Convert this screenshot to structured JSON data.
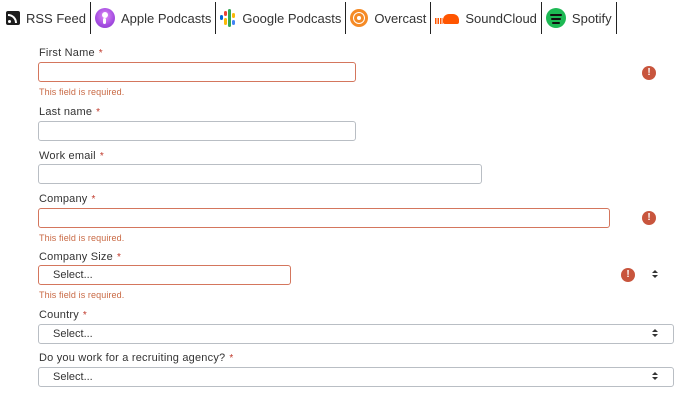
{
  "podcast_links": [
    {
      "label": "RSS Feed",
      "icon": "rss-icon"
    },
    {
      "label": "Apple Podcasts",
      "icon": "apple-podcasts-icon"
    },
    {
      "label": "Google Podcasts",
      "icon": "google-podcasts-icon"
    },
    {
      "label": "Overcast",
      "icon": "overcast-icon"
    },
    {
      "label": "SoundCloud",
      "icon": "soundcloud-icon"
    },
    {
      "label": "Spotify",
      "icon": "spotify-icon"
    }
  ],
  "form": {
    "required_marker": "*",
    "error_message": "This field is required.",
    "error_icon_glyph": "!",
    "first_name": {
      "label": "First Name",
      "value": ""
    },
    "last_name": {
      "label": "Last name",
      "value": ""
    },
    "work_email": {
      "label": "Work email",
      "value": ""
    },
    "company": {
      "label": "Company",
      "value": ""
    },
    "company_size": {
      "label": "Company Size",
      "selected": "Select..."
    },
    "country": {
      "label": "Country",
      "selected": "Select..."
    },
    "recruiting_agency": {
      "label": "Do you work for a recruiting agency?",
      "selected": "Select..."
    }
  },
  "colors": {
    "error": "#c8553d",
    "error_border": "#d4765d",
    "error_text": "#c96a45",
    "input_border": "#b9bec4"
  }
}
